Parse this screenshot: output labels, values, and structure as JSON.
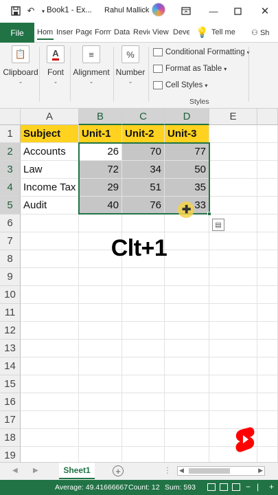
{
  "titlebar": {
    "save_icon": "save-icon",
    "undo_icon": "undo-icon",
    "customize_icon": "customize-icon",
    "title": "Book1 - Ex...",
    "user_name": "Rahul Mallick",
    "ribbon_display_icon": "ribbon-display-icon",
    "minimize_icon": "minimize-icon",
    "restore_icon": "restore-icon",
    "close_icon": "close-icon"
  },
  "menu": {
    "file": "File",
    "tabs": [
      "Hom",
      "Inser",
      "Page",
      "Form",
      "Data",
      "Revie",
      "View",
      "Deve"
    ],
    "tell_me": "Tell me",
    "share": "Sh"
  },
  "ribbon": {
    "clipboard": "Clipboard",
    "font": "Font",
    "alignment": "Alignment",
    "number": "Number",
    "number_symbol": "%",
    "conditional_formatting": "Conditional Formatting",
    "format_as_table": "Format as Table",
    "cell_styles": "Cell Styles",
    "styles_group": "Styles"
  },
  "sheet": {
    "columns": [
      "A",
      "B",
      "C",
      "D",
      "E"
    ],
    "rows": [
      "1",
      "2",
      "3",
      "4",
      "5",
      "6",
      "7",
      "8",
      "9",
      "10",
      "11",
      "12",
      "13",
      "14",
      "15",
      "16",
      "17",
      "18",
      "19"
    ],
    "header": [
      "Subject",
      "Unit-1",
      "Unit-2",
      "Unit-3"
    ],
    "data": [
      [
        "Accounts",
        "26",
        "70",
        "77"
      ],
      [
        "Law",
        "72",
        "34",
        "50"
      ],
      [
        "Income Tax",
        "29",
        "51",
        "35"
      ],
      [
        "Audit",
        "40",
        "76",
        "33"
      ]
    ],
    "header_color": "#ffd21f",
    "selection_color": "#217346"
  },
  "overlay": {
    "caption": "Clt+1"
  },
  "tabs": {
    "sheet1": "Sheet1",
    "add_sheet": "+"
  },
  "status": {
    "average": "Average: 49.41666667",
    "count": "Count: 12",
    "sum": "Sum: 593"
  }
}
